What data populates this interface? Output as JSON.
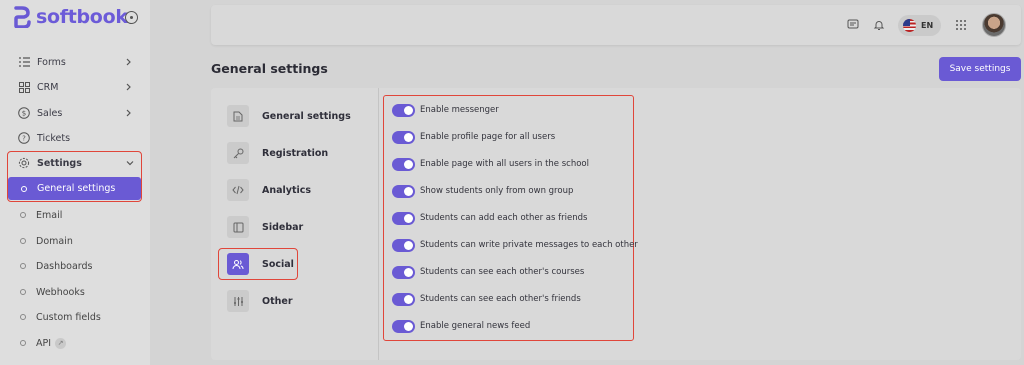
{
  "brand": {
    "name": "softbook",
    "color": "#6a5ad4"
  },
  "sidebar": {
    "items": [
      {
        "label": "Forms",
        "icon": "list-icon"
      },
      {
        "label": "CRM",
        "icon": "grid-icon"
      },
      {
        "label": "Sales",
        "icon": "dollar-icon"
      },
      {
        "label": "Tickets",
        "icon": "question-icon"
      }
    ],
    "settings": {
      "label": "Settings",
      "icon": "gear-icon",
      "active_child": "General settings"
    },
    "sub_items": [
      "Email",
      "Domain",
      "Dashboards",
      "Webhooks",
      "Custom fields",
      "API"
    ]
  },
  "header": {
    "language": "EN"
  },
  "page": {
    "title": "General settings",
    "save_label": "Save settings"
  },
  "tabs": [
    {
      "label": "General settings",
      "icon": "document-icon"
    },
    {
      "label": "Registration",
      "icon": "key-icon"
    },
    {
      "label": "Analytics",
      "icon": "code-icon"
    },
    {
      "label": "Sidebar",
      "icon": "sidebar-icon"
    },
    {
      "label": "Social",
      "icon": "users-icon",
      "active": true
    },
    {
      "label": "Other",
      "icon": "sliders-icon"
    }
  ],
  "social_settings": [
    {
      "label": "Enable messenger",
      "enabled": true
    },
    {
      "label": "Enable profile page for all users",
      "enabled": true
    },
    {
      "label": "Enable page with all users in the school",
      "enabled": true
    },
    {
      "label": "Show students only from own group",
      "enabled": true
    },
    {
      "label": "Students can add each other as friends",
      "enabled": true
    },
    {
      "label": "Students can write private messages to each other",
      "enabled": true
    },
    {
      "label": "Students can see each other's courses",
      "enabled": true
    },
    {
      "label": "Students can see each other's friends",
      "enabled": true
    },
    {
      "label": "Enable general news feed",
      "enabled": true
    }
  ]
}
